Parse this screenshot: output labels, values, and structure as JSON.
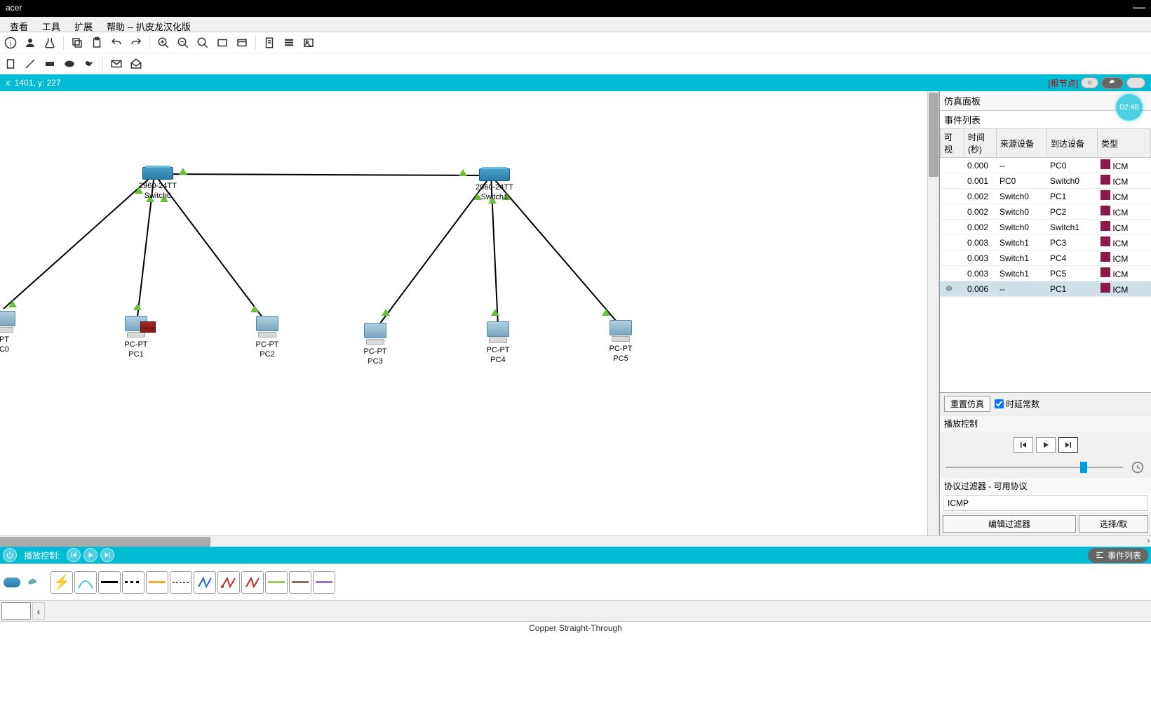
{
  "title": "acer",
  "menu": {
    "view": "查看",
    "tools": "工具",
    "ext": "扩展",
    "help": "帮助 -- 扒皮龙汉化版"
  },
  "coords": "x: 1401, y: 227",
  "root_node": "[根节点]",
  "timer": "02:48",
  "sim": {
    "panel": "仿真面板",
    "events": "事件列表",
    "headers": {
      "vis": "可视",
      "time": "时间 (秒)",
      "src": "来源设备",
      "dst": "到达设备",
      "type": "类型"
    },
    "rows": [
      {
        "time": "0.000",
        "src": "--",
        "dst": "PC0",
        "type": "ICM",
        "color": "#8b1a4a"
      },
      {
        "time": "0.001",
        "src": "PC0",
        "dst": "Switch0",
        "type": "ICM",
        "color": "#8b1a4a"
      },
      {
        "time": "0.002",
        "src": "Switch0",
        "dst": "PC1",
        "type": "ICM",
        "color": "#8b1a4a"
      },
      {
        "time": "0.002",
        "src": "Switch0",
        "dst": "PC2",
        "type": "ICM",
        "color": "#8b1a4a"
      },
      {
        "time": "0.002",
        "src": "Switch0",
        "dst": "Switch1",
        "type": "ICM",
        "color": "#8b1a4a"
      },
      {
        "time": "0.003",
        "src": "Switch1",
        "dst": "PC3",
        "type": "ICM",
        "color": "#8b1a4a"
      },
      {
        "time": "0.003",
        "src": "Switch1",
        "dst": "PC4",
        "type": "ICM",
        "color": "#8b1a4a"
      },
      {
        "time": "0.003",
        "src": "Switch1",
        "dst": "PC5",
        "type": "ICM",
        "color": "#8b1a4a"
      },
      {
        "time": "0.006",
        "src": "--",
        "dst": "PC1",
        "type": "ICM",
        "color": "#8b1a4a",
        "sel": true,
        "eye": true
      }
    ],
    "reset": "重置仿真",
    "constant": "时延常数",
    "playback": "播放控制",
    "filter_title": "协议过滤器 - 可用协议",
    "proto": "ICMP",
    "edit_filter": "编辑过滤器",
    "select": "选择/取"
  },
  "bottom": {
    "play_label": "播放控制:",
    "evlist": "事件列表"
  },
  "devices": {
    "sw0": {
      "model": "2960-24TT",
      "name": "Switch0"
    },
    "sw1": {
      "model": "2960-24TT",
      "name": "Switch1"
    },
    "pc0": {
      "type": "PT",
      "name": "C0"
    },
    "pc1": {
      "type": "PC-PT",
      "name": "PC1"
    },
    "pc2": {
      "type": "PC-PT",
      "name": "PC2"
    },
    "pc3": {
      "type": "PC-PT",
      "name": "PC3"
    },
    "pc4": {
      "type": "PC-PT",
      "name": "PC4"
    },
    "pc5": {
      "type": "PC-PT",
      "name": "PC5"
    }
  },
  "status": "Copper Straight-Through"
}
